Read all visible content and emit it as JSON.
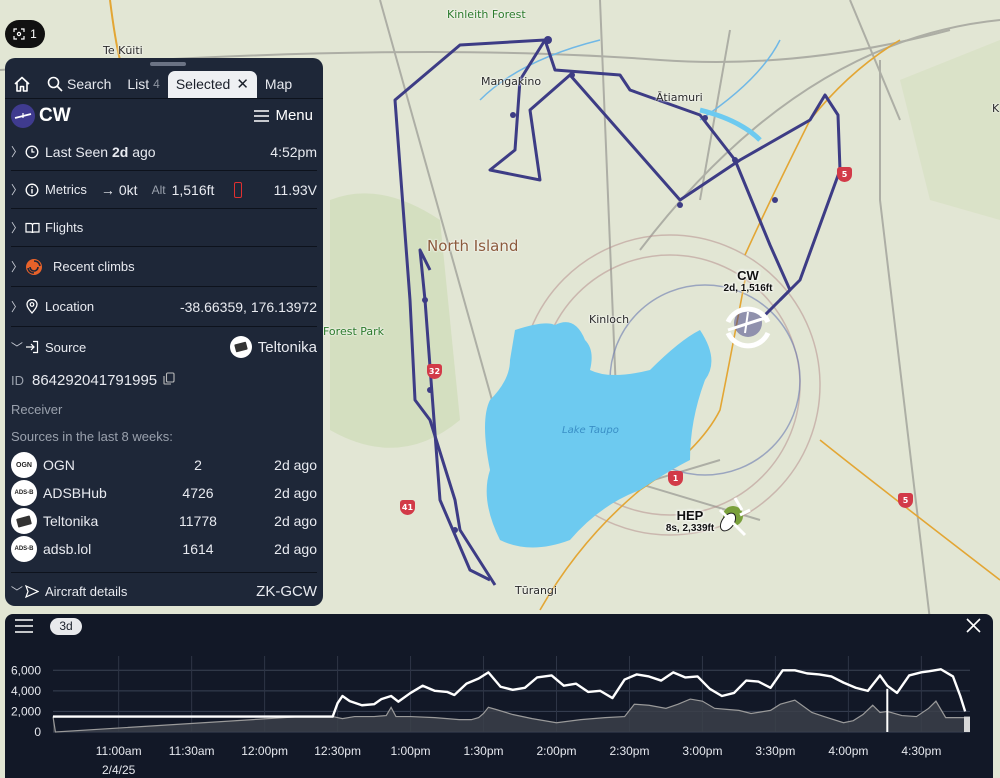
{
  "map": {
    "labels": {
      "te_kuiti": "Te Kūiti",
      "kinleith_forest": "Kinleith Forest",
      "mangakino": "Mangakino",
      "atiamuri": "Ātiamuri",
      "north_island": "North Island",
      "forest_park": "Forest Park",
      "kinloch": "Kinloch",
      "lake_taupo": "Lake Taupo",
      "turangi": "Tūrangi"
    },
    "highway_shields": [
      "5",
      "32",
      "1",
      "41",
      "5"
    ],
    "aircraft": [
      {
        "name": "CW",
        "detail": "2d, 1,516ft",
        "selected": true
      },
      {
        "name": "HEP",
        "detail": "8s, 2,339ft",
        "selected": false
      }
    ],
    "track_color": "#3d3c85",
    "water_color": "#6dcaf0"
  },
  "focus_badge": {
    "icon": "focus-icon",
    "count": "1"
  },
  "panel": {
    "tabs": [
      {
        "icon": "home-icon",
        "label": ""
      },
      {
        "icon": "search-icon",
        "label": "Search"
      },
      {
        "label": "List",
        "count": "4"
      },
      {
        "label": "Selected",
        "active": true,
        "closable": true
      },
      {
        "label": "Map"
      }
    ],
    "callsign": "CW",
    "menu_label": "Menu",
    "last_seen": {
      "prefix": "Last Seen",
      "value": "2d",
      "suffix": "ago",
      "time": "4:52pm"
    },
    "metrics": {
      "label": "Metrics",
      "speed": "0kt",
      "alt_label": "Alt",
      "alt": "1,516ft",
      "voltage": "11.93V",
      "battery_color": "#e03030"
    },
    "flights_label": "Flights",
    "recent_climbs_label": "Recent climbs",
    "location": {
      "label": "Location",
      "value": "-38.66359, 176.13972"
    },
    "source": {
      "label": "Source",
      "value": "Teltonika",
      "id_label": "ID",
      "id": "864292041791995",
      "receiver_label": "Receiver",
      "sources_heading": "Sources in the last 8 weeks:"
    },
    "sources": [
      {
        "icon": "OGN",
        "name": "OGN",
        "count": "2",
        "time": "2d ago"
      },
      {
        "icon": "ADS-B",
        "name": "ADSBHub",
        "count": "4726",
        "time": "2d ago"
      },
      {
        "icon": "device",
        "name": "Teltonika",
        "count": "11778",
        "time": "2d ago"
      },
      {
        "icon": "ADS-B",
        "name": "adsb.lol",
        "count": "1614",
        "time": "2d ago"
      }
    ],
    "aircraft_details": {
      "label": "Aircraft details",
      "registration": "ZK-GCW"
    }
  },
  "chart_panel": {
    "range_label": "3d",
    "chart_data": {
      "type": "line",
      "title": "",
      "xlabel": "",
      "ylabel": "",
      "ylim": [
        0,
        7000
      ],
      "yticks": [
        0,
        2000,
        4000,
        6000
      ],
      "ytick_labels": [
        "0",
        "2,000",
        "4,000",
        "6,000"
      ],
      "xtick_labels": [
        "11:00am",
        "11:30am",
        "12:00pm",
        "12:30pm",
        "1:00pm",
        "1:30pm",
        "2:00pm",
        "2:30pm",
        "3:00pm",
        "3:30pm",
        "4:00pm",
        "4:30pm"
      ],
      "xtick_minutes": [
        660,
        690,
        720,
        750,
        780,
        810,
        840,
        870,
        900,
        930,
        960,
        990
      ],
      "date_label": "2/4/25",
      "xlim_minutes": [
        633,
        1010
      ],
      "grid": true,
      "cursor_minute": 976,
      "series": [
        {
          "name": "altitude",
          "color": "#ffffff",
          "x": [
            633,
            634,
            735,
            748,
            750,
            752,
            755,
            760,
            765,
            768,
            772,
            775,
            780,
            785,
            790,
            795,
            798,
            803,
            808,
            812,
            817,
            822,
            827,
            832,
            838,
            843,
            848,
            853,
            858,
            863,
            868,
            873,
            878,
            883,
            888,
            893,
            898,
            903,
            908,
            913,
            918,
            923,
            928,
            933,
            938,
            943,
            948,
            953,
            958,
            963,
            968,
            973,
            976,
            980,
            985,
            990,
            993,
            998,
            1003,
            1006,
            1008
          ],
          "values": [
            1500,
            1500,
            1500,
            1500,
            2800,
            3500,
            3000,
            2600,
            2700,
            3200,
            3500,
            2950,
            3800,
            4500,
            4000,
            3900,
            3600,
            4700,
            5200,
            5800,
            4400,
            4100,
            4300,
            5300,
            5500,
            4500,
            4700,
            3900,
            4000,
            3300,
            5100,
            5600,
            5400,
            5000,
            5800,
            5300,
            5400,
            4200,
            3500,
            3800,
            5000,
            4900,
            4300,
            6000,
            6000,
            5700,
            5600,
            5400,
            4800,
            4300,
            4000,
            5500,
            4500,
            3800,
            5500,
            5800,
            5900,
            6100,
            5400,
            3500,
            2000
          ]
        },
        {
          "name": "ground",
          "color": "#9a9a9a",
          "x": [
            633,
            634,
            735,
            748,
            752,
            757,
            765,
            770,
            772,
            774,
            780,
            790,
            800,
            805,
            808,
            810,
            812,
            815,
            822,
            830,
            840,
            850,
            860,
            868,
            872,
            878,
            885,
            890,
            895,
            900,
            905,
            910,
            915,
            920,
            928,
            932,
            938,
            945,
            950,
            958,
            962,
            966,
            970,
            973,
            976,
            982,
            988,
            993,
            996,
            1000,
            1006,
            1008
          ],
          "values": [
            1500,
            0,
            1500,
            1500,
            1300,
            1500,
            1500,
            1600,
            2400,
            1500,
            1500,
            1400,
            1200,
            1200,
            1400,
            1800,
            2400,
            2200,
            1700,
            1300,
            900,
            1200,
            1400,
            1500,
            2700,
            2600,
            2300,
            2700,
            3200,
            3000,
            2300,
            2200,
            2100,
            1800,
            2100,
            2700,
            3100,
            1900,
            1500,
            900,
            1100,
            1700,
            2600,
            1900,
            2000,
            1600,
            1500,
            2300,
            3000,
            1400,
            1400,
            1400
          ]
        }
      ]
    }
  }
}
